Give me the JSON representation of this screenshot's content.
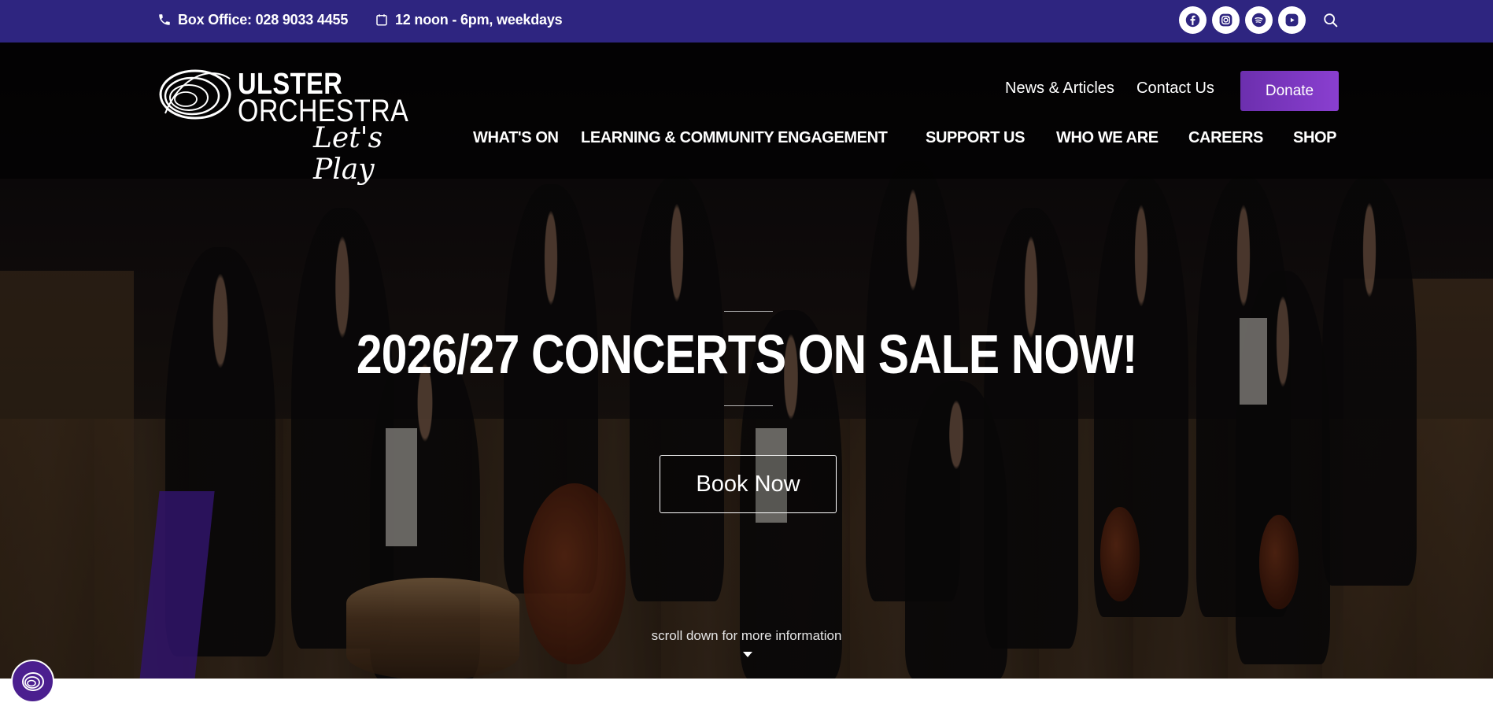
{
  "topbar": {
    "phone_text": "Box Office: 028 9033 4455",
    "hours_text": "12 noon - 6pm, weekdays",
    "icons": [
      "phone-icon",
      "calendar-icon",
      "facebook-icon",
      "instagram-icon",
      "spotify-icon",
      "youtube-icon",
      "search-icon"
    ]
  },
  "header": {
    "logo": {
      "line1": "ULSTER",
      "line2": "ORCHESTRA",
      "tagline": "Let's Play"
    },
    "top_links": {
      "news": "News & Articles",
      "contact": "Contact Us"
    },
    "donate_label": "Donate",
    "nav": {
      "whats_on": "WHAT'S ON",
      "learning": "LEARNING & COMMUNITY ENGAGEMENT",
      "support": "SUPPORT US",
      "who": "WHO WE ARE",
      "careers": "CAREERS",
      "shop": "SHOP"
    }
  },
  "hero": {
    "headline": "2026/27 CONCERTS ON SALE NOW!",
    "cta_label": "Book Now",
    "scroll_hint": "scroll down for more information"
  },
  "colors": {
    "topbar": "#2e2580",
    "donate": "#7a36c0",
    "chat_badge": "#4b1f8f"
  }
}
